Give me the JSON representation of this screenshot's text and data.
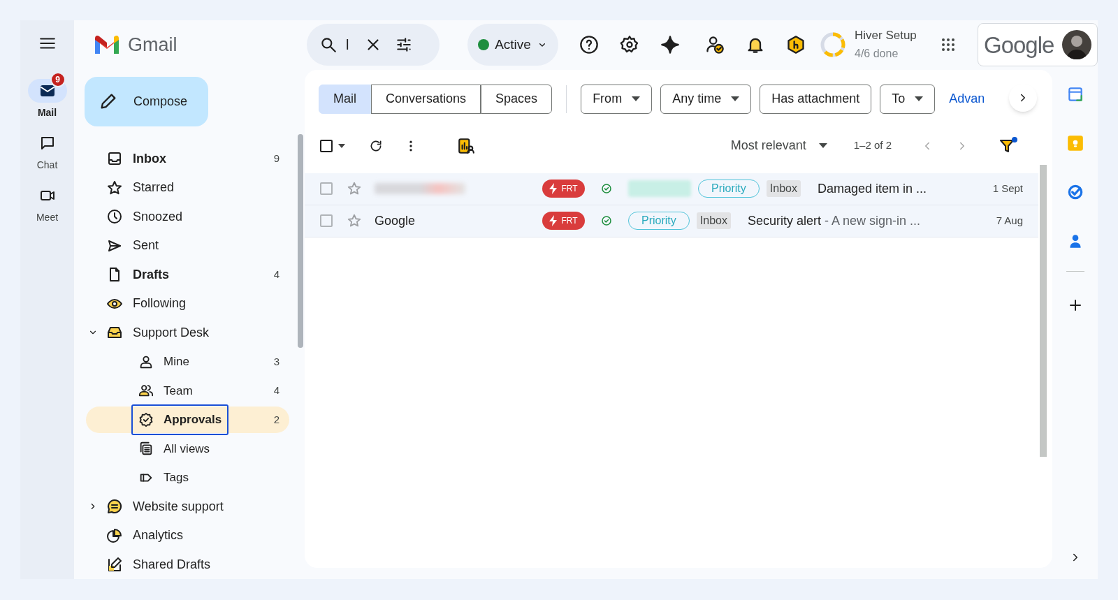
{
  "rail": [
    {
      "label": "Mail",
      "selected": true,
      "badge": "9"
    },
    {
      "label": "Chat",
      "selected": false
    },
    {
      "label": "Meet",
      "selected": false
    }
  ],
  "app_name": "Gmail",
  "search": {
    "value": "l"
  },
  "status": {
    "label": "Active"
  },
  "hiver_setup": {
    "title": "Hiver Setup",
    "progress": "4/6 done"
  },
  "account": {
    "logo": "Google"
  },
  "compose": "Compose",
  "folders": [
    {
      "label": "Inbox",
      "count": "9",
      "unread": true,
      "selected": false
    },
    {
      "label": "Starred",
      "unread": false,
      "selected": false
    },
    {
      "label": "Snoozed",
      "unread": false,
      "selected": false
    },
    {
      "label": "Sent",
      "unread": false,
      "selected": false
    },
    {
      "label": "Drafts",
      "count": "4",
      "unread": true,
      "selected": false
    },
    {
      "label": "Following",
      "unread": false,
      "selected": false
    },
    {
      "label": "Support Desk",
      "unread": false,
      "selected": false,
      "expanded": true,
      "children": [
        {
          "label": "Mine",
          "count": "3",
          "selected": false
        },
        {
          "label": "Team",
          "count": "4",
          "selected": false
        },
        {
          "label": "Approvals",
          "count": "2",
          "selected": true
        },
        {
          "label": "All views",
          "selected": false
        },
        {
          "label": "Tags",
          "selected": false
        }
      ]
    },
    {
      "label": "Website support",
      "unread": false,
      "selected": false,
      "expanded": false
    },
    {
      "label": "Analytics",
      "unread": false,
      "selected": false
    },
    {
      "label": "Shared Drafts",
      "unread": false,
      "selected": false
    }
  ],
  "search_tabs": [
    {
      "label": "Mail",
      "selected": true
    },
    {
      "label": "Conversations",
      "selected": false
    },
    {
      "label": "Spaces",
      "selected": false
    }
  ],
  "filters": [
    {
      "label": "From",
      "dropdown": true
    },
    {
      "label": "Any time",
      "dropdown": true
    },
    {
      "label": "Has attachment",
      "dropdown": false
    },
    {
      "label": "To",
      "dropdown": true
    }
  ],
  "advanced_link": "Advan",
  "toolbar": {
    "select_all_checked": false,
    "sort": "Most relevant",
    "range": "1–2 of 2"
  },
  "rows": [
    {
      "checked": false,
      "sender_redacted": true,
      "tags": [
        {
          "kind": "frt",
          "text": "FRT"
        },
        {
          "kind": "check"
        },
        {
          "kind": "redacted"
        },
        {
          "kind": "priority",
          "text": "Priority"
        },
        {
          "kind": "inbox",
          "text": "Inbox"
        }
      ],
      "subject": "Damaged item in ...",
      "date": "1 Sept"
    },
    {
      "checked": false,
      "sender": "Google",
      "sender_redacted": false,
      "tags": [
        {
          "kind": "frt",
          "text": "FRT"
        },
        {
          "kind": "check"
        },
        {
          "kind": "priority",
          "text": "Priority"
        },
        {
          "kind": "inbox",
          "text": "Inbox"
        }
      ],
      "subject": "Security alert",
      "snippet": " - A new sign-in ...",
      "date": "7 Aug"
    }
  ]
}
